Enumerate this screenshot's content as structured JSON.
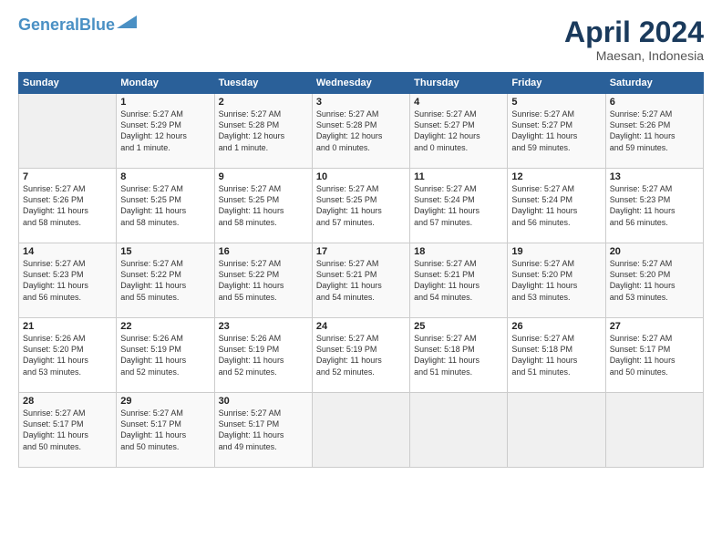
{
  "header": {
    "logo_line1": "General",
    "logo_line2": "Blue",
    "month": "April 2024",
    "location": "Maesan, Indonesia"
  },
  "columns": [
    "Sunday",
    "Monday",
    "Tuesday",
    "Wednesday",
    "Thursday",
    "Friday",
    "Saturday"
  ],
  "weeks": [
    [
      {
        "day": "",
        "info": ""
      },
      {
        "day": "1",
        "info": "Sunrise: 5:27 AM\nSunset: 5:29 PM\nDaylight: 12 hours\nand 1 minute."
      },
      {
        "day": "2",
        "info": "Sunrise: 5:27 AM\nSunset: 5:28 PM\nDaylight: 12 hours\nand 1 minute."
      },
      {
        "day": "3",
        "info": "Sunrise: 5:27 AM\nSunset: 5:28 PM\nDaylight: 12 hours\nand 0 minutes."
      },
      {
        "day": "4",
        "info": "Sunrise: 5:27 AM\nSunset: 5:27 PM\nDaylight: 12 hours\nand 0 minutes."
      },
      {
        "day": "5",
        "info": "Sunrise: 5:27 AM\nSunset: 5:27 PM\nDaylight: 11 hours\nand 59 minutes."
      },
      {
        "day": "6",
        "info": "Sunrise: 5:27 AM\nSunset: 5:26 PM\nDaylight: 11 hours\nand 59 minutes."
      }
    ],
    [
      {
        "day": "7",
        "info": "Sunrise: 5:27 AM\nSunset: 5:26 PM\nDaylight: 11 hours\nand 58 minutes."
      },
      {
        "day": "8",
        "info": "Sunrise: 5:27 AM\nSunset: 5:25 PM\nDaylight: 11 hours\nand 58 minutes."
      },
      {
        "day": "9",
        "info": "Sunrise: 5:27 AM\nSunset: 5:25 PM\nDaylight: 11 hours\nand 58 minutes."
      },
      {
        "day": "10",
        "info": "Sunrise: 5:27 AM\nSunset: 5:25 PM\nDaylight: 11 hours\nand 57 minutes."
      },
      {
        "day": "11",
        "info": "Sunrise: 5:27 AM\nSunset: 5:24 PM\nDaylight: 11 hours\nand 57 minutes."
      },
      {
        "day": "12",
        "info": "Sunrise: 5:27 AM\nSunset: 5:24 PM\nDaylight: 11 hours\nand 56 minutes."
      },
      {
        "day": "13",
        "info": "Sunrise: 5:27 AM\nSunset: 5:23 PM\nDaylight: 11 hours\nand 56 minutes."
      }
    ],
    [
      {
        "day": "14",
        "info": "Sunrise: 5:27 AM\nSunset: 5:23 PM\nDaylight: 11 hours\nand 56 minutes."
      },
      {
        "day": "15",
        "info": "Sunrise: 5:27 AM\nSunset: 5:22 PM\nDaylight: 11 hours\nand 55 minutes."
      },
      {
        "day": "16",
        "info": "Sunrise: 5:27 AM\nSunset: 5:22 PM\nDaylight: 11 hours\nand 55 minutes."
      },
      {
        "day": "17",
        "info": "Sunrise: 5:27 AM\nSunset: 5:21 PM\nDaylight: 11 hours\nand 54 minutes."
      },
      {
        "day": "18",
        "info": "Sunrise: 5:27 AM\nSunset: 5:21 PM\nDaylight: 11 hours\nand 54 minutes."
      },
      {
        "day": "19",
        "info": "Sunrise: 5:27 AM\nSunset: 5:20 PM\nDaylight: 11 hours\nand 53 minutes."
      },
      {
        "day": "20",
        "info": "Sunrise: 5:27 AM\nSunset: 5:20 PM\nDaylight: 11 hours\nand 53 minutes."
      }
    ],
    [
      {
        "day": "21",
        "info": "Sunrise: 5:26 AM\nSunset: 5:20 PM\nDaylight: 11 hours\nand 53 minutes."
      },
      {
        "day": "22",
        "info": "Sunrise: 5:26 AM\nSunset: 5:19 PM\nDaylight: 11 hours\nand 52 minutes."
      },
      {
        "day": "23",
        "info": "Sunrise: 5:26 AM\nSunset: 5:19 PM\nDaylight: 11 hours\nand 52 minutes."
      },
      {
        "day": "24",
        "info": "Sunrise: 5:27 AM\nSunset: 5:19 PM\nDaylight: 11 hours\nand 52 minutes."
      },
      {
        "day": "25",
        "info": "Sunrise: 5:27 AM\nSunset: 5:18 PM\nDaylight: 11 hours\nand 51 minutes."
      },
      {
        "day": "26",
        "info": "Sunrise: 5:27 AM\nSunset: 5:18 PM\nDaylight: 11 hours\nand 51 minutes."
      },
      {
        "day": "27",
        "info": "Sunrise: 5:27 AM\nSunset: 5:17 PM\nDaylight: 11 hours\nand 50 minutes."
      }
    ],
    [
      {
        "day": "28",
        "info": "Sunrise: 5:27 AM\nSunset: 5:17 PM\nDaylight: 11 hours\nand 50 minutes."
      },
      {
        "day": "29",
        "info": "Sunrise: 5:27 AM\nSunset: 5:17 PM\nDaylight: 11 hours\nand 50 minutes."
      },
      {
        "day": "30",
        "info": "Sunrise: 5:27 AM\nSunset: 5:17 PM\nDaylight: 11 hours\nand 49 minutes."
      },
      {
        "day": "",
        "info": ""
      },
      {
        "day": "",
        "info": ""
      },
      {
        "day": "",
        "info": ""
      },
      {
        "day": "",
        "info": ""
      }
    ]
  ]
}
